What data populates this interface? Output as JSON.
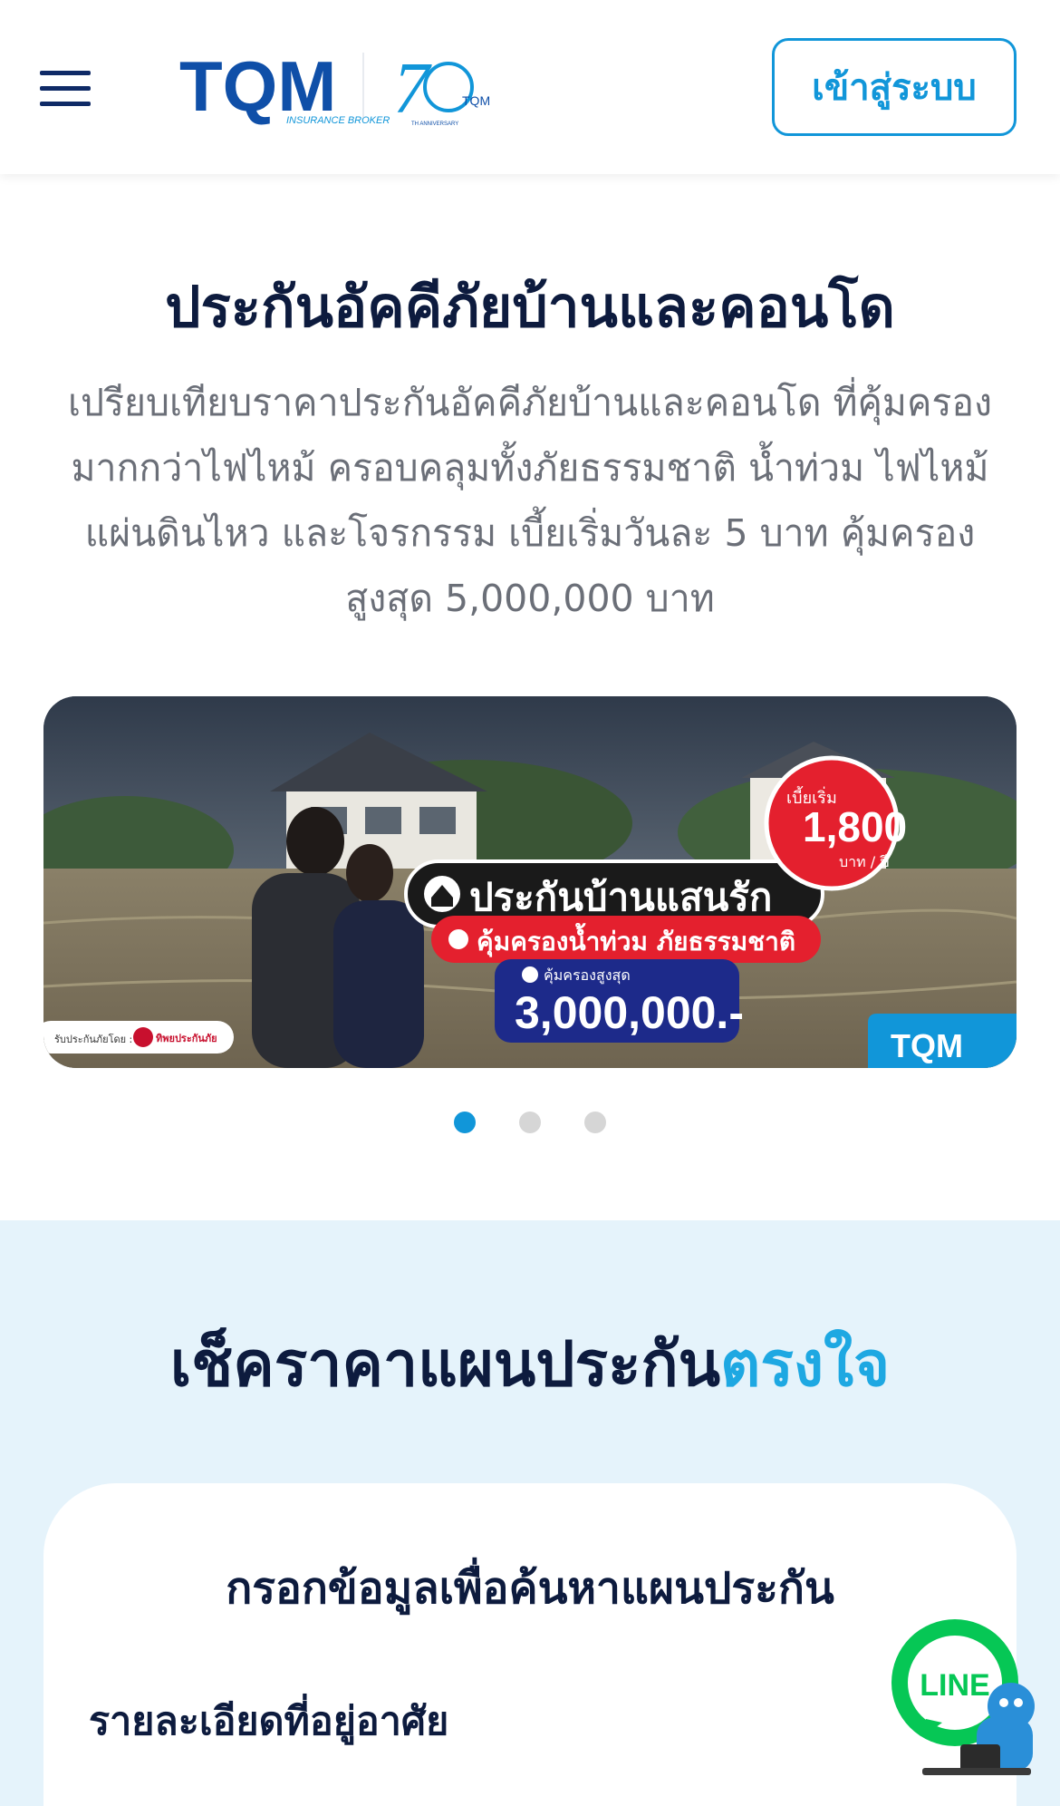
{
  "header": {
    "logo_text": "TQM",
    "logo_sub": "INSURANCE BROKER",
    "anniv_text": "7",
    "anniv_brand": "TQM",
    "anniv_caption": "TH ANNIVERSARY",
    "login_label": "เข้าสู่ระบบ"
  },
  "hero": {
    "title": "ประกันอัคคีภัยบ้านและคอนโด",
    "description": "เปรียบเทียบราคาประกันอัคคีภัยบ้านและคอนโด ที่คุ้มครองมากกว่าไฟไหม้ ครอบคลุมทั้งภัยธรรมชาติ น้ำท่วม ไฟไหม้ แผ่นดินไหว และโจรกรรม เบี้ยเริ่มวันละ 5 บาท คุ้มครองสูงสุด 5,000,000 บาท"
  },
  "banner": {
    "headline": "ประกันบ้านแสนรัก",
    "sub_headline": "คุ้มครองน้ำท่วม ภัยธรรมชาติ",
    "max_label": "คุ้มครองสูงสุด",
    "max_value": "3,000,000.-",
    "price_label": "เบี้ยเริ่ม",
    "price_value": "1,800",
    "price_unit": "บาท / ปี",
    "insurer_label": "รับประกันภัยโดย :",
    "insurer_name": "ทิพยประกันภัย",
    "brand": "TQM",
    "slide_count": 3,
    "active_slide": 1
  },
  "check": {
    "title_main": "เช็คราคาแผนประกัน",
    "title_accent": "ตรงใจ",
    "form_title": "กรอกข้อมูลเพื่อค้นหาแผนประกัน",
    "form_label": "รายละเอียดที่อยู่อาศัย"
  },
  "fab": {
    "label": "LINE"
  },
  "colors": {
    "primary": "#1196d9",
    "navy": "#0f2a66",
    "accent": "#1ea8e2",
    "section_bg": "#e5f3fb",
    "line_green": "#06c755"
  }
}
